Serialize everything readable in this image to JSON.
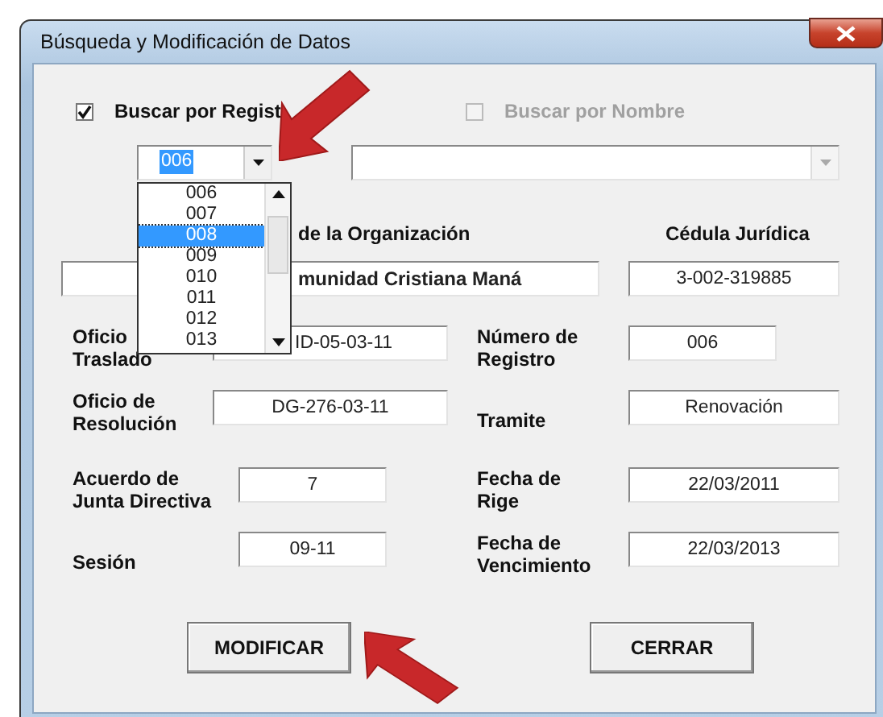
{
  "window": {
    "title": "Búsqueda y Modificación de Datos"
  },
  "search_options": [
    {
      "label": "Buscar por Regist",
      "checked": true,
      "disabled": false
    },
    {
      "label": "Buscar por Nombre",
      "checked": false,
      "disabled": true
    }
  ],
  "registro_combo": {
    "value": "006"
  },
  "nombre_combo": {
    "disabled": true
  },
  "dropdown_items": [
    {
      "label": "006",
      "selected": false
    },
    {
      "label": "007",
      "selected": false
    },
    {
      "label": "008",
      "selected": true
    },
    {
      "label": "009",
      "selected": false
    },
    {
      "label": "010",
      "selected": false
    },
    {
      "label": "011",
      "selected": false
    },
    {
      "label": "012",
      "selected": false
    },
    {
      "label": "013",
      "selected": false
    }
  ],
  "headers": [
    "de la Organización",
    "Cédula Jurídica"
  ],
  "org_name": "munidad Cristiana Maná",
  "cedula": "3-002-319885",
  "rows": [
    {
      "left": {
        "label": "Oficio\nTraslado",
        "value": "ID-05-03-11"
      },
      "right": {
        "label": "Número de\nRegistro",
        "value": "006"
      }
    },
    {
      "left": {
        "label": "Oficio de\nResolución",
        "value": "DG-276-03-11"
      },
      "right": {
        "label": "Tramite",
        "value": "Renovación"
      }
    },
    {
      "left": {
        "label": "Acuerdo de\nJunta Directiva",
        "value": "7"
      },
      "right": {
        "label": "Fecha de\nRige",
        "value": "22/03/2011"
      }
    },
    {
      "left": {
        "label": "Sesión",
        "value": "09-11"
      },
      "right": {
        "label": "Fecha de\nVencimiento",
        "value": "22/03/2013"
      }
    }
  ],
  "buttons": [
    "MODIFICAR",
    "CERRAR"
  ]
}
